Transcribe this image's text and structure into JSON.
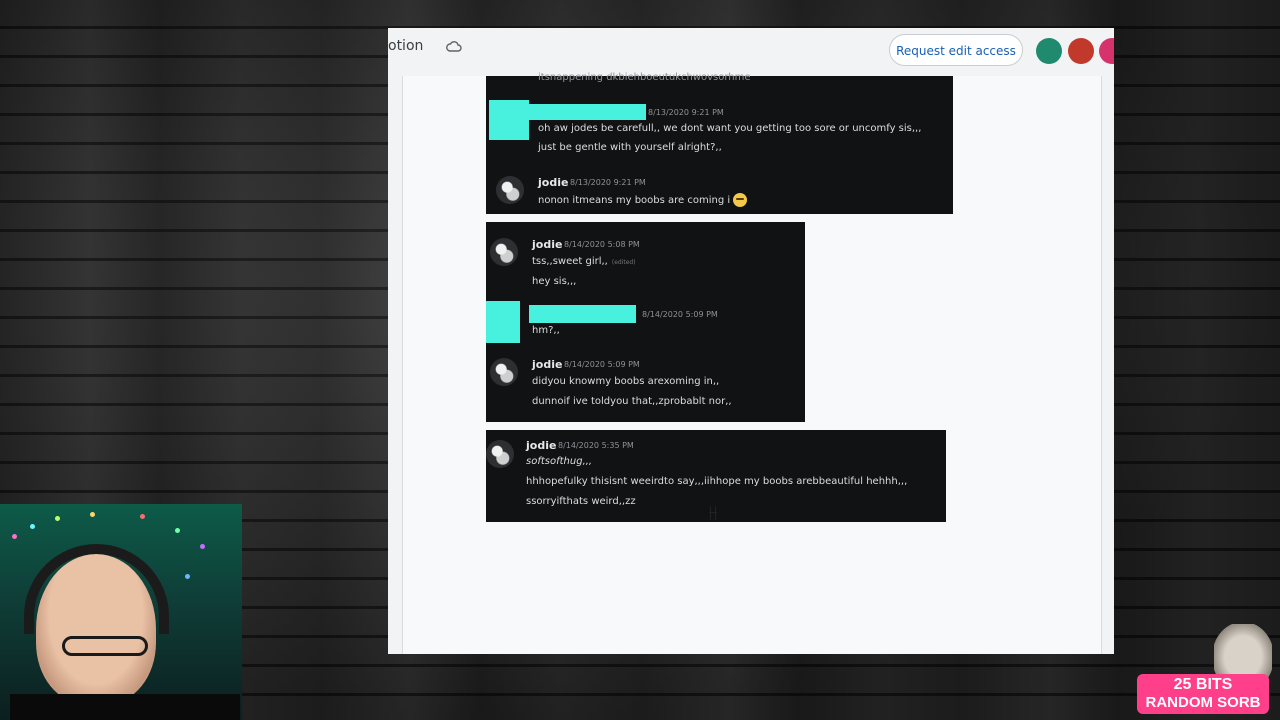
{
  "doc": {
    "title_fragment": "otion",
    "request_label": "Request edit access"
  },
  "shot1": {
    "cutoff": "itsnappening dkbiehboeutukchwovsorhme",
    "m1_time": "8/13/2020 9:21 PM",
    "m1_l1": "oh aw jodes be carefull,, we dont want you getting too sore or uncomfy sis,,,",
    "m1_l2": "just be gentle with yourself alright?,,",
    "m2_name": "jodie",
    "m2_time": "8/13/2020 9:21 PM",
    "m2_l1": "nonon itmeans my boobs are coming i"
  },
  "shot2": {
    "m1_name": "jodie",
    "m1_time": "8/14/2020 5:08 PM",
    "m1_l1": "tss,,sweet girl,,",
    "m1_edited": "(edited)",
    "m1_l2": "hey sis,,,",
    "m2_time": "8/14/2020 5:09 PM",
    "m2_l1": "hm?,,",
    "m3_name": "jodie",
    "m3_time": "8/14/2020 5:09 PM",
    "m3_l1": "didyou knowmy boobs arexoming in,,",
    "m3_l2": "dunnoif ive toldyou that,,zprobablt nor,,"
  },
  "shot3": {
    "m1_name": "jodie",
    "m1_time": "8/14/2020 5:35 PM",
    "m1_l1": "softsofthug,,,",
    "m1_l2": "hhhopefulky thisisnt weeirdto say,,,iihhope my boobs arebbeautiful hehhh,,,",
    "m1_l3": "ssorryifthats weird,,zz"
  },
  "badge": {
    "line1": "25 BITS",
    "line2": "RANDOM SORB"
  },
  "colors": {
    "redaction": "#48f1dd",
    "discord_bg": "#111214",
    "badge": "#ff3f8a",
    "link_blue": "#1a5fb4"
  }
}
